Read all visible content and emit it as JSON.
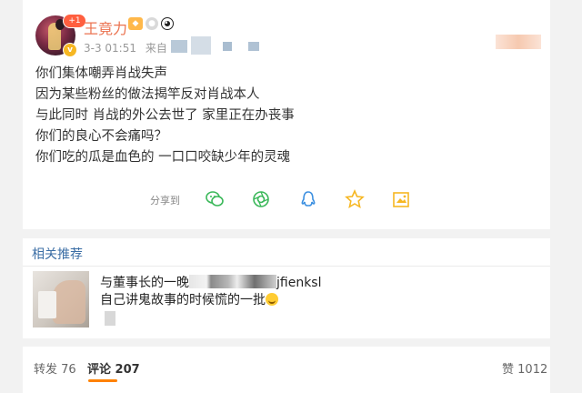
{
  "post": {
    "username": "王竟力",
    "notification_badge": "+1",
    "verified_mark": "v",
    "user_badges": [
      "level-icon",
      "medal-icon",
      "panda-icon"
    ],
    "timestamp": "3-3 01:51",
    "source_prefix": "来自",
    "content_lines": [
      "你们集体嘲弄肖战失声",
      "因为某些粉丝的做法揭竿反对肖战本人",
      "与此同时 肖战的外公去世了 家里正在办丧事",
      "你们的良心不会痛吗？",
      "你们吃的瓜是血色的 一口口咬缺少年的灵魂"
    ],
    "share_label": "分享到",
    "share_icons": [
      "wechat-icon",
      "moments-icon",
      "qq-icon",
      "qzone-star-icon",
      "save-image-icon"
    ]
  },
  "related": {
    "title": "相关推荐",
    "item": {
      "line1_start": "与董事长的一晚",
      "line1_end": "jfienksl",
      "line2": "自己讲鬼故事的时候慌的一批"
    }
  },
  "stats": {
    "repost_label": "转发",
    "repost_count": "76",
    "comment_label": "评论",
    "comment_count": "207",
    "like_label": "赞",
    "like_count": "1012"
  },
  "colors": {
    "username": "#eb7350",
    "link_blue": "#3b6ea5",
    "accent_orange": "#ff8200",
    "share_orange": "#f6b723",
    "share_green": "#3bb85a",
    "share_blue": "#3b8fe0"
  }
}
